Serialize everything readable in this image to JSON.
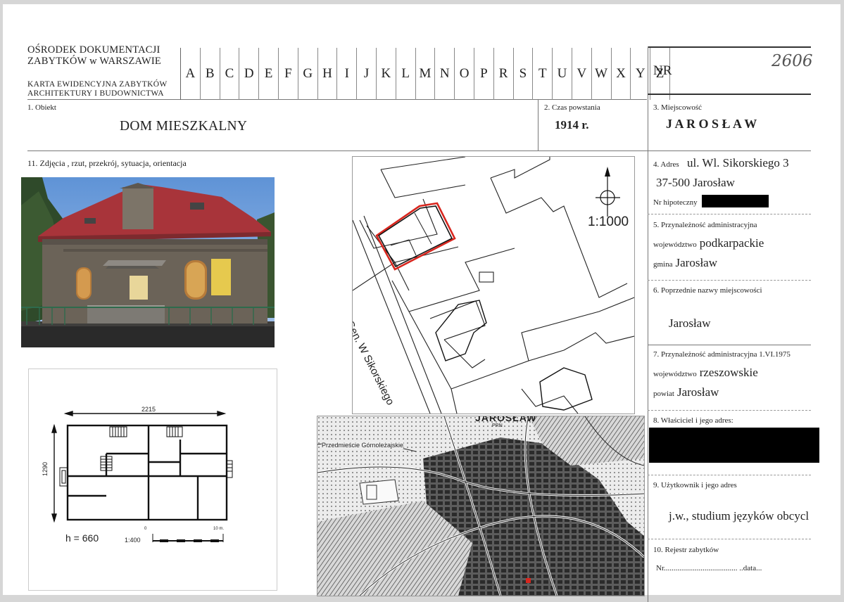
{
  "header": {
    "institution_line1": "OŚRODEK DOKUMENTACJI",
    "institution_line2": "ZABYTKÓW w WARSZAWIE",
    "card_title_line1": "KARTA EWIDENCYJNA ZABYTKÓW",
    "card_title_line2": "ARCHITEKTURY I BUDOWNICTWA",
    "letters": [
      "A",
      "B",
      "C",
      "D",
      "E",
      "F",
      "G",
      "H",
      "I",
      "J",
      "K",
      "L",
      "M",
      "N",
      "O",
      "P",
      "R",
      "S",
      "T",
      "U",
      "V",
      "W",
      "X",
      "Y",
      "Z"
    ],
    "nr_label": "NR",
    "nr_value": "2606"
  },
  "fields": {
    "obiekt": {
      "label": "1. Obiekt",
      "value": "DOM MIESZKALNY"
    },
    "czas": {
      "label": "2. Czas powstania",
      "value": "1914 r."
    },
    "miejscowosc": {
      "label": "3. Miejscowość",
      "value": "J A R O S Ł A W"
    },
    "zdjecia_label": "11. Zdjęcia , rzut, przekrój, sytuacja, orientacja",
    "adres": {
      "label": "4. Adres",
      "line1": "ul. Wl. Sikorskiego 3",
      "line2": "37-500 Jarosław",
      "hipoteczny_label": "Nr hipoteczny"
    },
    "przynaleznosc": {
      "label": "5. Przynależność administracyjna",
      "woj_label": "województwo",
      "woj_value": "podkarpackie",
      "gmina_label": "gmina",
      "gmina_value": "Jarosław"
    },
    "poprzednie": {
      "label": "6. Poprzednie nazwy miejscowości",
      "value": "Jarosław"
    },
    "przynaleznosc1975": {
      "label": "7. Przynależność administracyjna 1.VI.1975",
      "woj_label": "województwo",
      "woj_value": "rzeszowskie",
      "powiat_label": "powiat",
      "powiat_value": "Jarosław"
    },
    "wlasciciel": {
      "label": "8. Właściciel i jego adres:"
    },
    "uzytkownik": {
      "label": "9. Użytkownik i jego adres",
      "value": "j.w., studium języków obcycl"
    },
    "rejestr": {
      "label": "10. Rejestr zabytków",
      "nr_text": "Nr...................................... ..data..."
    }
  },
  "plan": {
    "width_label": "2215",
    "depth_label": "1290",
    "height_label": "h = 660",
    "scale_label": "1:400",
    "scale_zero": "0",
    "scale_ten": "10 m."
  },
  "situation_map": {
    "street_label": "Gen. W Sikorskiego",
    "scale": "1:1000"
  },
  "city_map": {
    "title": "JAROSŁAW",
    "sub": "PRN",
    "district": "Przedmieście Górnoleżajskie"
  },
  "colors": {
    "roof": "#a8343a",
    "facade": "#6b6358",
    "sky": "#6f9fd8",
    "tree": "#2f4a2a",
    "plot_red": "#d8261e"
  }
}
